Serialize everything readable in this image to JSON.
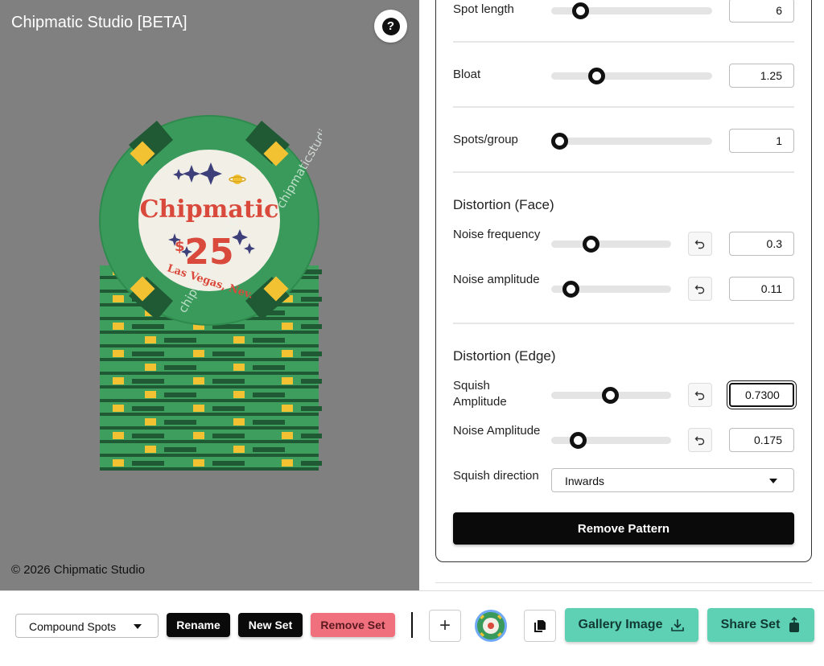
{
  "app": {
    "title": "Chipmatic Studio [BETA]",
    "help_label": "?",
    "copyright": "© 2026 Chipmatic Studio"
  },
  "chip": {
    "brand": "Chipmatic",
    "currency": "$",
    "denomination": "25",
    "location": "Las Vegas, Nev.",
    "watermark": "chipmaticstudio.com",
    "colors": {
      "main": "#3d9e5e",
      "dark": "#1f5a34",
      "insert": "#f2efe6",
      "accent": "#f2c232",
      "text": "#d94a3c",
      "stars": "#3c3f7a"
    }
  },
  "panel": {
    "spot_length": {
      "label": "Spot length",
      "value": "6",
      "fraction": 0.18
    },
    "bloat": {
      "label": "Bloat",
      "value": "1.25",
      "fraction": 0.28
    },
    "spots_group": {
      "label": "Spots/group",
      "value": "1",
      "fraction": 0.05
    },
    "distortion_face": {
      "title": "Distortion (Face)",
      "noise_frequency": {
        "label": "Noise frequency",
        "value": "0.3",
        "fraction": 0.33
      },
      "noise_amplitude": {
        "label": "Noise amplitude",
        "value": "0.11",
        "fraction": 0.16
      }
    },
    "distortion_edge": {
      "title": "Distortion (Edge)",
      "squish_amplitude": {
        "label": "Squish Amplitude",
        "value": "0.7300",
        "fraction": 0.49
      },
      "noise_amplitude": {
        "label": "Noise Amplitude",
        "value": "0.175",
        "fraction": 0.22
      },
      "squish_direction": {
        "label": "Squish direction",
        "value": "Inwards"
      }
    },
    "remove_pattern_label": "Remove Pattern"
  },
  "toolbar": {
    "set_select_value": "Compound Spots",
    "rename_label": "Rename",
    "new_set_label": "New Set",
    "remove_set_label": "Remove Set",
    "add_label": "+",
    "gallery_label": "Gallery Image",
    "share_label": "Share Set",
    "colors": {
      "teal": "#5ed1b5",
      "danger": "#f0707d"
    }
  }
}
